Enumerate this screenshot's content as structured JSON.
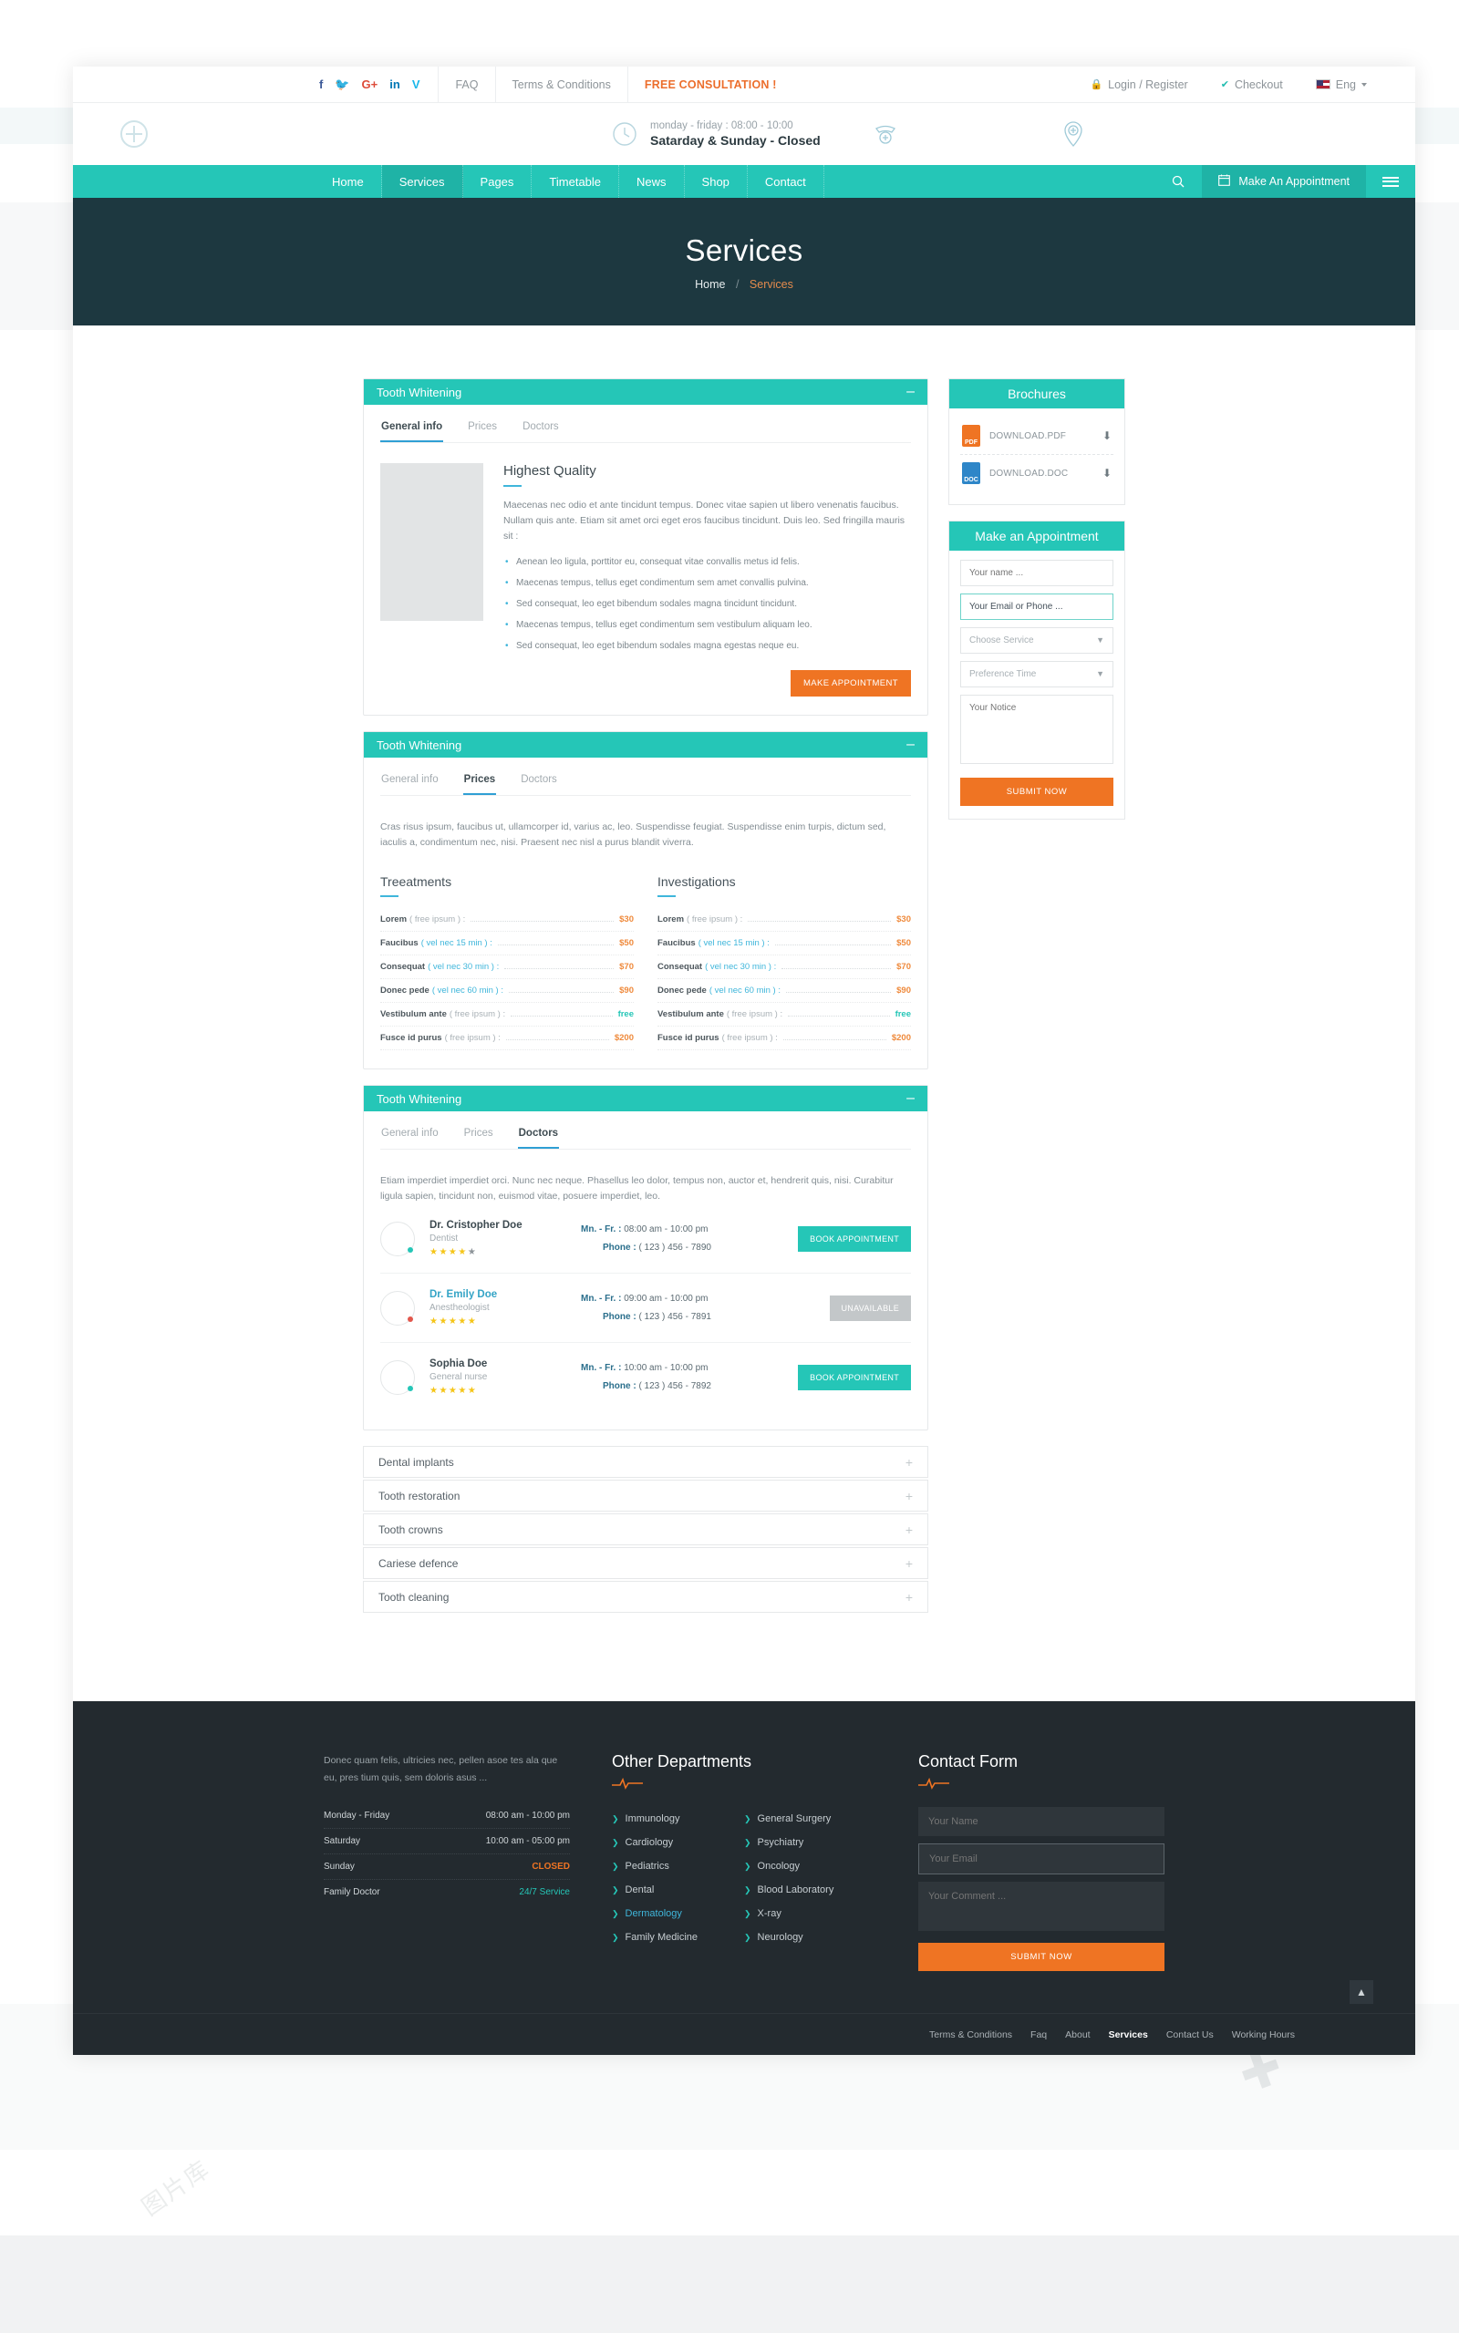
{
  "topbar": {
    "social": [
      {
        "name": "facebook-icon",
        "glyph": "f",
        "cls": "s-fb"
      },
      {
        "name": "twitter-icon",
        "glyph": "🐦",
        "cls": "s-tw"
      },
      {
        "name": "google-plus-icon",
        "glyph": "G+",
        "cls": "s-gp"
      },
      {
        "name": "linkedin-icon",
        "glyph": "in",
        "cls": "s-in"
      },
      {
        "name": "vimeo-icon",
        "glyph": "V",
        "cls": "s-vm"
      }
    ],
    "faq": "FAQ",
    "terms": "Terms & Conditions",
    "promo": "FREE CONSULTATION !",
    "login": "Login / Register",
    "checkout": "Checkout",
    "lang": "Eng"
  },
  "header": {
    "hours_line1": "monday - friday : 08:00 - 10:00",
    "hours_line2": "Satarday & Sunday - Closed"
  },
  "nav": {
    "items": [
      {
        "label": "Home",
        "active": false
      },
      {
        "label": "Services",
        "active": true
      },
      {
        "label": "Pages",
        "active": false
      },
      {
        "label": "Timetable",
        "active": false
      },
      {
        "label": "News",
        "active": false
      },
      {
        "label": "Shop",
        "active": false
      },
      {
        "label": "Contact",
        "active": false
      }
    ],
    "appointment_label": "Make An Appointment"
  },
  "hero": {
    "title": "Services",
    "crumb_home": "Home",
    "crumb_sep": "/",
    "crumb_current": "Services"
  },
  "accordions": {
    "open": [
      {
        "title": "Tooth Whitening",
        "sign": "–",
        "tabs": [
          {
            "label": "General info",
            "active": true
          },
          {
            "label": "Prices",
            "active": false
          },
          {
            "label": "Doctors",
            "active": false
          }
        ]
      },
      {
        "title": "Tooth Whitening",
        "sign": "–",
        "tabs": [
          {
            "label": "General info",
            "active": false
          },
          {
            "label": "Prices",
            "active": true
          },
          {
            "label": "Doctors",
            "active": false
          }
        ]
      },
      {
        "title": "Tooth Whitening",
        "sign": "–",
        "tabs": [
          {
            "label": "General info",
            "active": false
          },
          {
            "label": "Prices",
            "active": false
          },
          {
            "label": "Doctors",
            "active": true
          }
        ]
      }
    ],
    "closed": [
      {
        "title": "Dental implants",
        "sign": "+"
      },
      {
        "title": "Tooth restoration",
        "sign": "+"
      },
      {
        "title": "Tooth crowns",
        "sign": "+"
      },
      {
        "title": "Cariese defence",
        "sign": "+"
      },
      {
        "title": "Tooth cleaning",
        "sign": "+"
      }
    ]
  },
  "general_info": {
    "heading": "Highest Quality",
    "paragraph": "Maecenas nec odio et ante tincidunt tempus. Donec vitae sapien ut libero venenatis faucibus. Nullam quis ante. Etiam sit amet orci eget eros faucibus tincidunt. Duis leo. Sed fringilla mauris sit :",
    "bullets": [
      "Aenean leo ligula, porttitor eu, consequat vitae convallis metus id felis.",
      "Maecenas tempus, tellus eget condimentum sem amet convallis pulvina.",
      "Sed consequat, leo eget bibendum sodales magna tincidunt tincidunt.",
      "Maecenas tempus, tellus eget condimentum sem vestibulum aliquam leo.",
      "Sed consequat, leo eget bibendum sodales magna egestas neque eu."
    ],
    "cta": "MAKE APPOINTMENT"
  },
  "prices": {
    "intro": "Cras risus ipsum, faucibus ut, ullamcorper id, varius ac, leo. Suspendisse feugiat. Suspendisse enim turpis, dictum sed, iaculis a, condimentum nec, nisi. Praesent nec nisl a purus blandit viverra.",
    "col1_title": "Treeatments",
    "col2_title": "Investigations",
    "rows": [
      {
        "name": "Lorem",
        "sub": "( free ipsum ) :",
        "sub_blue": false,
        "amount": "$30",
        "free": false
      },
      {
        "name": "Faucibus",
        "sub": "( vel nec 15 min ) :",
        "sub_blue": true,
        "amount": "$50",
        "free": false
      },
      {
        "name": "Consequat",
        "sub": "( vel nec 30 min ) :",
        "sub_blue": true,
        "amount": "$70",
        "free": false
      },
      {
        "name": "Donec pede",
        "sub": "( vel nec 60 min ) :",
        "sub_blue": true,
        "amount": "$90",
        "free": false
      },
      {
        "name": "Vestibulum ante",
        "sub": "( free ipsum ) :",
        "sub_blue": false,
        "amount": "free",
        "free": true
      },
      {
        "name": "Fusce id purus",
        "sub": "( free ipsum ) :",
        "sub_blue": false,
        "amount": "$200",
        "free": false
      }
    ]
  },
  "doctors": {
    "intro": "Etiam imperdiet imperdiet orci. Nunc nec neque. Phasellus leo dolor, tempus non, auctor et, hendrerit quis, nisi. Curabitur ligula sapien, tincidunt non, euismod vitae, posuere imperdiet, leo.",
    "hours_label": "Mn. - Fr. :",
    "phone_label": "Phone :",
    "list": [
      {
        "name": "Dr. Cristopher Doe",
        "name_link": false,
        "role": "Dentist",
        "status": "on",
        "stars": 4,
        "stars_total": 5,
        "hours": "08:00 am - 10:00 pm",
        "phone": "( 123 ) 456 - 7890",
        "button": "BOOK APPOINTMENT",
        "available": true
      },
      {
        "name": "Dr. Emily Doe",
        "name_link": true,
        "role": "Anestheologist",
        "status": "off",
        "stars": 5,
        "stars_total": 5,
        "hours": "09:00 am - 10:00 pm",
        "phone": "( 123 ) 456 - 7891",
        "button": "UNAVAILABLE",
        "available": false
      },
      {
        "name": "Sophia Doe",
        "name_link": false,
        "role": "General nurse",
        "status": "on",
        "stars": 5,
        "stars_total": 5,
        "hours": "10:00 am - 10:00 pm",
        "phone": "( 123 ) 456 - 7892",
        "button": "BOOK APPOINTMENT",
        "available": true
      }
    ]
  },
  "sidebar": {
    "brochures_title": "Brochures",
    "brochures": [
      {
        "label": "DOWNLOAD.PDF",
        "type": "PDF"
      },
      {
        "label": "DOWNLOAD.DOC",
        "type": "DOC"
      }
    ],
    "appointment_title": "Make an Appointment",
    "form": {
      "name_placeholder": "Your name ...",
      "email_value": "Your Email or Phone ...",
      "service_value": "Choose Service",
      "time_value": "Preference Time",
      "notice_placeholder": "Your Notice",
      "submit": "SUBMIT NOW"
    }
  },
  "footer": {
    "about_text": "Donec quam felis, ultricies nec, pellen asoe tes ala que eu, pres tium quis, sem doloris asus ...",
    "hours": [
      {
        "day": "Monday - Friday",
        "value": "08:00 am - 10:00 pm",
        "kind": "normal"
      },
      {
        "day": "Saturday",
        "value": "10:00 am - 05:00 pm",
        "kind": "normal"
      },
      {
        "day": "Sunday",
        "value": "CLOSED",
        "kind": "closed"
      },
      {
        "day": "Family Doctor",
        "value": "24/7 Service",
        "kind": "svc"
      }
    ],
    "departments_title": "Other Departments",
    "departments": [
      {
        "label": "Immunology",
        "active": false
      },
      {
        "label": "General Surgery",
        "active": false
      },
      {
        "label": "Cardiology",
        "active": false
      },
      {
        "label": "Psychiatry",
        "active": false
      },
      {
        "label": "Pediatrics",
        "active": false
      },
      {
        "label": "Oncology",
        "active": false
      },
      {
        "label": "Dental",
        "active": false
      },
      {
        "label": "Blood Laboratory",
        "active": false
      },
      {
        "label": "Dermatology",
        "active": true
      },
      {
        "label": "X-ray",
        "active": false
      },
      {
        "label": "Family Medicine",
        "active": false
      },
      {
        "label": "Neurology",
        "active": false
      }
    ],
    "contact_title": "Contact Form",
    "contact_form": {
      "name_placeholder": "Your Name",
      "email_placeholder": "Your Email",
      "comment_placeholder": "Your Comment ...",
      "submit": "SUBMIT NOW"
    },
    "bottom_links": [
      {
        "label": "Terms & Conditions",
        "on": false
      },
      {
        "label": "Faq",
        "on": false
      },
      {
        "label": "About",
        "on": false
      },
      {
        "label": "Services",
        "on": true
      },
      {
        "label": "Contact Us",
        "on": false
      },
      {
        "label": "Working Hours",
        "on": false
      }
    ]
  },
  "colors": {
    "teal": "#25c6b7",
    "teal_dark": "#1fb3a6",
    "orange": "#ef7423",
    "navy": "#1d3840",
    "blue": "#3fb6db",
    "footer_bg": "#232a2f"
  }
}
